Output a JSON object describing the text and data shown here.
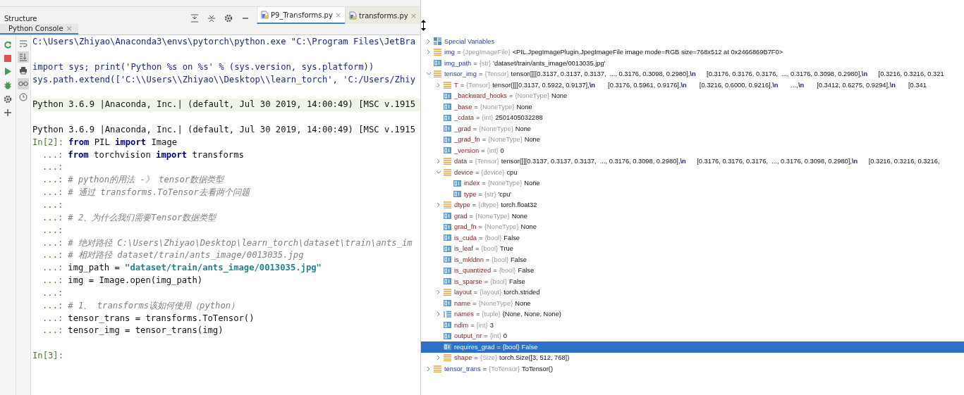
{
  "structure_panel": {
    "title": "Structure"
  },
  "editor_tabs": [
    {
      "label": "P9_Transforms.py",
      "close": "×",
      "selected": true
    },
    {
      "label": "transforms.py",
      "close": "×",
      "selected": false
    }
  ],
  "console_tabs": [
    {
      "label": "Python Console",
      "close": "×",
      "selected": true
    }
  ],
  "console_toolbar": [
    {
      "kind": "rerun"
    },
    {
      "kind": "stop"
    },
    {
      "kind": "run"
    },
    {
      "kind": "debug"
    },
    {
      "kind": "settings"
    },
    {
      "kind": "add"
    }
  ],
  "console_options": [
    {
      "kind": "wrap",
      "on": false
    },
    {
      "kind": "scroll-end",
      "on": true
    },
    {
      "kind": "print",
      "on": false
    },
    {
      "kind": "glasses",
      "on": true
    },
    {
      "kind": "history",
      "on": false
    }
  ],
  "console_lines": [
    {
      "kind": "text",
      "segments": [
        {
          "kind": "output",
          "text": "C:\\Users\\Zhiyao\\Anaconda3\\envs\\pytorch\\python.exe \"C:\\Program Files\\JetBra"
        }
      ]
    },
    {
      "kind": "blank"
    },
    {
      "kind": "text",
      "segments": [
        {
          "kind": "output",
          "text": "import sys; print('Python %s on %s' % (sys.version, sys.platform))"
        }
      ]
    },
    {
      "kind": "text",
      "segments": [
        {
          "kind": "output",
          "text": "sys.path.extend(['C:\\\\Users\\\\Zhiyao\\\\Desktop\\\\learn_torch', 'C:/Users/Zhiy"
        }
      ]
    },
    {
      "kind": "blank"
    },
    {
      "kind": "text",
      "highlighted": true,
      "segments": [
        {
          "kind": "plain",
          "text": "Python 3.6.9 |Anaconda, Inc.| (default, Jul 30 2019, 14:00:49) [MSC v.1915"
        }
      ]
    },
    {
      "kind": "blank"
    },
    {
      "kind": "text",
      "segments": [
        {
          "kind": "plain",
          "text": "Python 3.6.9 |Anaconda, Inc.| (default, Jul 30 2019, 14:00:49) [MSC v.1915"
        }
      ]
    },
    {
      "kind": "input",
      "prompt": "In[2]:",
      "segments": [
        {
          "kind": "keyword",
          "text": "from"
        },
        {
          "kind": "plain",
          "text": " PIL "
        },
        {
          "kind": "keyword",
          "text": "import"
        },
        {
          "kind": "plain",
          "text": " Image"
        }
      ]
    },
    {
      "kind": "continuation",
      "prompt": "...:",
      "segments": [
        {
          "kind": "keyword",
          "text": "from"
        },
        {
          "kind": "plain",
          "text": " torchvision "
        },
        {
          "kind": "keyword",
          "text": "import"
        },
        {
          "kind": "plain",
          "text": " transforms"
        }
      ]
    },
    {
      "kind": "continuation",
      "prompt": "...:"
    },
    {
      "kind": "continuation",
      "prompt": "...:",
      "segments": [
        {
          "kind": "comment",
          "text": "# python的用法 -》 tensor数据类型"
        }
      ]
    },
    {
      "kind": "continuation",
      "prompt": "...:",
      "segments": [
        {
          "kind": "comment",
          "text": "# 通过 transforms.ToTensor去看两个问题"
        }
      ]
    },
    {
      "kind": "continuation",
      "prompt": "...:"
    },
    {
      "kind": "continuation",
      "prompt": "...:",
      "segments": [
        {
          "kind": "comment",
          "text": "# 2、为什么我们需要Tensor数据类型"
        }
      ]
    },
    {
      "kind": "continuation",
      "prompt": "...:"
    },
    {
      "kind": "continuation",
      "prompt": "...:",
      "segments": [
        {
          "kind": "comment",
          "text": "# 绝对路径 C:\\Users\\Zhiyao\\Desktop\\learn_torch\\dataset\\train\\ants_im"
        }
      ]
    },
    {
      "kind": "continuation",
      "prompt": "...:",
      "segments": [
        {
          "kind": "comment",
          "text": "# 相对路径 dataset/train/ants_image/0013035.jpg"
        }
      ]
    },
    {
      "kind": "continuation",
      "prompt": "...:",
      "segments": [
        {
          "kind": "plain",
          "text": "img_path = "
        },
        {
          "kind": "string",
          "text": "\"dataset/train/ants_image/0013035.jpg\""
        }
      ]
    },
    {
      "kind": "continuation",
      "prompt": "...:",
      "segments": [
        {
          "kind": "plain",
          "text": "img = Image.open(img_path)"
        }
      ]
    },
    {
      "kind": "continuation",
      "prompt": "...:"
    },
    {
      "kind": "continuation",
      "prompt": "...:",
      "segments": [
        {
          "kind": "comment",
          "text": "# 1、 transforms该如何使用（python）"
        }
      ]
    },
    {
      "kind": "continuation",
      "prompt": "...:",
      "segments": [
        {
          "kind": "plain",
          "text": "tensor_trans = transforms.ToTensor()"
        }
      ]
    },
    {
      "kind": "continuation",
      "prompt": "...:",
      "segments": [
        {
          "kind": "plain",
          "text": "tensor_img = tensor_trans(img)"
        }
      ]
    },
    {
      "kind": "blank"
    },
    {
      "kind": "input",
      "prompt": "In[3]:"
    }
  ],
  "variables": [
    {
      "kind": "special",
      "name": "Special Variables",
      "expanded": false,
      "selected": false
    },
    {
      "kind": "object",
      "name": "img",
      "sep": "=",
      "type": "{JpegImageFile}",
      "value": "<PIL.JpegImagePlugin.JpegImageFile image mode=RGB size=768x512 at 0x2466869B7F0>",
      "expanded": false,
      "selected": false
    },
    {
      "kind": "scalar",
      "name": "img_path",
      "sep": "=",
      "type": "{str}",
      "value": "'dataset/train/ants_image/0013035.jpg'",
      "selected": false
    },
    {
      "kind": "object",
      "name": "tensor_img",
      "sep": "=",
      "type": "{Tensor}",
      "value": "tensor([[[0.3137, 0.3137, 0.3137,  ..., 0.3176, 0.3098, 0.2980],**\\n**      [0.3176, 0.3176, 0.3176,  ..., 0.3176, 0.3098, 0.2980],**\\n**      [0.3216, 0.3216, 0.321",
      "expanded": true,
      "selected": false,
      "children": [
        {
          "kind": "object",
          "name": "T",
          "sep": "=",
          "type": "{Tensor}",
          "value": "tensor([[[0.3137, 0.5922, 0.9137],**\\n**       [0.3176, 0.5961, 0.9176],**\\n**       [0.3216, 0.6000, 0.9216],**\\n**       ...,**\\n**       [0.3412, 0.6275, 0.9294],**\\n**       [0.341",
          "expanded": false,
          "selected": false
        },
        {
          "kind": "scalar",
          "name": "_backward_hooks",
          "sep": "=",
          "type": "{NoneType}",
          "value": "None",
          "selected": false
        },
        {
          "kind": "scalar",
          "name": "_base",
          "sep": "=",
          "type": "{NoneType}",
          "value": "None",
          "selected": false
        },
        {
          "kind": "scalar",
          "name": "_cdata",
          "sep": "=",
          "type": "{int}",
          "value": "2501405032288",
          "selected": false
        },
        {
          "kind": "scalar",
          "name": "_grad",
          "sep": "=",
          "type": "{NoneType}",
          "value": "None",
          "selected": false
        },
        {
          "kind": "scalar",
          "name": "_grad_fn",
          "sep": "=",
          "type": "{NoneType}",
          "value": "None",
          "selected": false
        },
        {
          "kind": "scalar",
          "name": "_version",
          "sep": "=",
          "type": "{int}",
          "value": "0",
          "selected": false
        },
        {
          "kind": "object",
          "name": "data",
          "sep": "=",
          "type": "{Tensor}",
          "value": "tensor([[[0.3137, 0.3137, 0.3137,  ..., 0.3176, 0.3098, 0.2980],**\\n**      [0.3176, 0.3176, 0.3176,  ..., 0.3176, 0.3098, 0.2980],**\\n**      [0.3216, 0.3216, 0.3216,",
          "expanded": false,
          "selected": false
        },
        {
          "kind": "object",
          "name": "device",
          "sep": "=",
          "type": "{device}",
          "value": "cpu",
          "expanded": true,
          "selected": false,
          "children": [
            {
              "kind": "scalar",
              "name": "index",
              "sep": "=",
              "type": "{NoneType}",
              "value": "None",
              "selected": false
            },
            {
              "kind": "scalar",
              "name": "type",
              "sep": "=",
              "type": "{str}",
              "value": "'cpu'",
              "selected": false
            }
          ]
        },
        {
          "kind": "object",
          "name": "dtype",
          "sep": "=",
          "type": "{dtype}",
          "value": "torch.float32",
          "expanded": false,
          "selected": false
        },
        {
          "kind": "scalar",
          "name": "grad",
          "sep": "=",
          "type": "{NoneType}",
          "value": "None",
          "selected": false
        },
        {
          "kind": "scalar",
          "name": "grad_fn",
          "sep": "=",
          "type": "{NoneType}",
          "value": "None",
          "selected": false
        },
        {
          "kind": "scalar",
          "name": "is_cuda",
          "sep": "=",
          "type": "{bool}",
          "value": "False",
          "selected": false
        },
        {
          "kind": "scalar",
          "name": "is_leaf",
          "sep": "=",
          "type": "{bool}",
          "value": "True",
          "selected": false
        },
        {
          "kind": "scalar",
          "name": "is_mkldnn",
          "sep": "=",
          "type": "{bool}",
          "value": "False",
          "selected": false
        },
        {
          "kind": "scalar",
          "name": "is_quantized",
          "sep": "=",
          "type": "{bool}",
          "value": "False",
          "selected": false
        },
        {
          "kind": "scalar",
          "name": "is_sparse",
          "sep": "=",
          "type": "{bool}",
          "value": "False",
          "selected": false
        },
        {
          "kind": "object",
          "name": "layout",
          "sep": "=",
          "type": "{layout}",
          "value": "torch.strided",
          "expanded": false,
          "selected": false
        },
        {
          "kind": "scalar",
          "name": "name",
          "sep": "=",
          "type": "{NoneType}",
          "value": "None",
          "selected": false
        },
        {
          "kind": "tuple",
          "name": "names",
          "sep": "=",
          "type": "{tuple}",
          "value": "(None, None, None)",
          "expanded": false,
          "selected": false
        },
        {
          "kind": "scalar",
          "name": "ndim",
          "sep": "=",
          "type": "{int}",
          "value": "3",
          "selected": false
        },
        {
          "kind": "scalar",
          "name": "output_nr",
          "sep": "=",
          "type": "{int}",
          "value": "0",
          "selected": false
        },
        {
          "kind": "scalar",
          "name": "requires_grad",
          "sep": "=",
          "type": "{bool}",
          "value": "False",
          "selected": true
        },
        {
          "kind": "object",
          "name": "shape",
          "sep": "=",
          "type": "{Size}",
          "value": "torch.Size([3, 512, 768])",
          "expanded": false,
          "selected": false
        }
      ]
    },
    {
      "kind": "object",
      "name": "tensor_trans",
      "sep": "=",
      "type": "{ToTensor}",
      "value": "ToTensor()",
      "expanded": false,
      "selected": false
    }
  ]
}
